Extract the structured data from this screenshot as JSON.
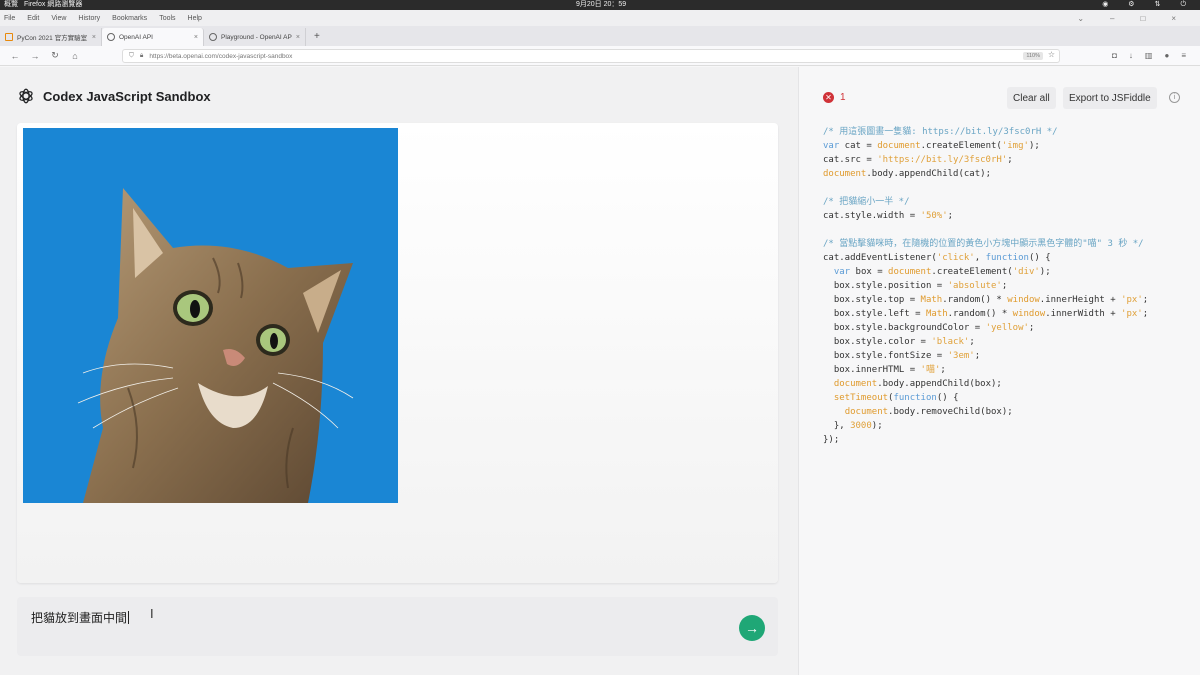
{
  "os": {
    "activities": "概覽",
    "app_name": "Firefox 網路瀏覽器",
    "clock": "9月20日 20：59"
  },
  "menu": [
    "File",
    "Edit",
    "View",
    "History",
    "Bookmarks",
    "Tools",
    "Help"
  ],
  "tabs": [
    {
      "label": "PyCon 2021 官方實驗室 Py",
      "close": "×"
    },
    {
      "label": "OpenAI API",
      "close": "×"
    },
    {
      "label": "Playground - OpenAI API",
      "close": "×"
    }
  ],
  "new_tab": "+",
  "address": {
    "url": "https://beta.openai.com/codex-javascript-sandbox",
    "zoom": "110%"
  },
  "sandbox": {
    "title": "Codex JavaScript Sandbox",
    "prompt_text": "把貓放到畫面中間",
    "error_count": "1",
    "clear_label": "Clear all",
    "export_label": "Export to JSFiddle",
    "info": "i",
    "send": "→"
  },
  "code": [
    [
      [
        "/* 用這張圖畫一隻貓: https://bit.ly/3fsc0rH */",
        "c-cm"
      ]
    ],
    [
      [
        "var",
        "c-kw"
      ],
      [
        " cat = ",
        ""
      ],
      [
        "document",
        "c-bi"
      ],
      [
        ".createElement(",
        ""
      ],
      [
        "'img'",
        "c-str"
      ],
      [
        ");",
        ""
      ]
    ],
    [
      [
        "cat.src = ",
        ""
      ],
      [
        "'https://bit.ly/3fsc0rH'",
        "c-str"
      ],
      [
        ";",
        ""
      ]
    ],
    [
      [
        "document",
        "c-bi"
      ],
      [
        ".body.appendChild(cat);",
        ""
      ]
    ],
    [
      [
        "",
        ""
      ]
    ],
    [
      [
        "/* 把貓縮小一半 */",
        "c-cm"
      ]
    ],
    [
      [
        "cat.style.width = ",
        ""
      ],
      [
        "'50%'",
        "c-str"
      ],
      [
        ";",
        ""
      ]
    ],
    [
      [
        "",
        ""
      ]
    ],
    [
      [
        "/* 當點擊貓咪時，在隨機的位置的黃色小方塊中顯示黑色字體的\"喵\" 3 秒 */",
        "c-cm"
      ]
    ],
    [
      [
        "cat.addEventListener(",
        ""
      ],
      [
        "'click'",
        "c-str"
      ],
      [
        ", ",
        ""
      ],
      [
        "function",
        "c-kw"
      ],
      [
        "() {",
        ""
      ]
    ],
    [
      [
        "  ",
        ""
      ],
      [
        "var",
        "c-kw"
      ],
      [
        " box = ",
        ""
      ],
      [
        "document",
        "c-bi"
      ],
      [
        ".createElement(",
        ""
      ],
      [
        "'div'",
        "c-str"
      ],
      [
        ");",
        ""
      ]
    ],
    [
      [
        "  box.style.position = ",
        ""
      ],
      [
        "'absolute'",
        "c-str"
      ],
      [
        ";",
        ""
      ]
    ],
    [
      [
        "  box.style.top = ",
        ""
      ],
      [
        "Math",
        "c-bi"
      ],
      [
        ".random() * ",
        ""
      ],
      [
        "window",
        "c-bi"
      ],
      [
        ".innerHeight + ",
        ""
      ],
      [
        "'px'",
        "c-str"
      ],
      [
        ";",
        ""
      ]
    ],
    [
      [
        "  box.style.left = ",
        ""
      ],
      [
        "Math",
        "c-bi"
      ],
      [
        ".random() * ",
        ""
      ],
      [
        "window",
        "c-bi"
      ],
      [
        ".innerWidth + ",
        ""
      ],
      [
        "'px'",
        "c-str"
      ],
      [
        ";",
        ""
      ]
    ],
    [
      [
        "  box.style.backgroundColor = ",
        ""
      ],
      [
        "'yellow'",
        "c-str"
      ],
      [
        ";",
        ""
      ]
    ],
    [
      [
        "  box.style.color = ",
        ""
      ],
      [
        "'black'",
        "c-str"
      ],
      [
        ";",
        ""
      ]
    ],
    [
      [
        "  box.style.fontSize = ",
        ""
      ],
      [
        "'3em'",
        "c-str"
      ],
      [
        ";",
        ""
      ]
    ],
    [
      [
        "  box.innerHTML = ",
        ""
      ],
      [
        "'喵'",
        "c-str"
      ],
      [
        ";",
        ""
      ]
    ],
    [
      [
        "  ",
        ""
      ],
      [
        "document",
        "c-bi"
      ],
      [
        ".body.appendChild(box);",
        ""
      ]
    ],
    [
      [
        "  ",
        ""
      ],
      [
        "setTimeout",
        "c-bi"
      ],
      [
        "(",
        ""
      ],
      [
        "function",
        "c-kw"
      ],
      [
        "() {",
        ""
      ]
    ],
    [
      [
        "    ",
        ""
      ],
      [
        "document",
        "c-bi"
      ],
      [
        ".body.removeChild(box);",
        ""
      ]
    ],
    [
      [
        "  }, ",
        ""
      ],
      [
        "3000",
        "c-str"
      ],
      [
        ");",
        ""
      ]
    ],
    [
      [
        "});",
        ""
      ]
    ]
  ],
  "colors": {
    "accent": "#1fa776",
    "error": "#d03238",
    "sky": "#1a86d4"
  }
}
